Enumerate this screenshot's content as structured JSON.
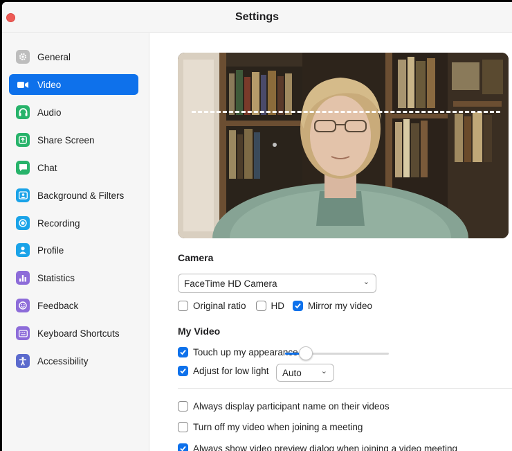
{
  "window": {
    "title": "Settings"
  },
  "sidebar": {
    "items": [
      {
        "label": "General",
        "icon": "gear-icon",
        "color": "#bdbdbd",
        "active": false
      },
      {
        "label": "Video",
        "icon": "video-camera-icon",
        "color": "#0e71eb",
        "active": true
      },
      {
        "label": "Audio",
        "icon": "headphones-icon",
        "color": "#27b36a",
        "active": false
      },
      {
        "label": "Share Screen",
        "icon": "share-screen-icon",
        "color": "#27b36a",
        "active": false
      },
      {
        "label": "Chat",
        "icon": "chat-bubble-icon",
        "color": "#27b36a",
        "active": false
      },
      {
        "label": "Background & Filters",
        "icon": "background-person-icon",
        "color": "#1aa3e8",
        "active": false
      },
      {
        "label": "Recording",
        "icon": "record-icon",
        "color": "#1aa3e8",
        "active": false
      },
      {
        "label": "Profile",
        "icon": "person-icon",
        "color": "#1aa3e8",
        "active": false
      },
      {
        "label": "Statistics",
        "icon": "bar-chart-icon",
        "color": "#8d6cd9",
        "active": false
      },
      {
        "label": "Feedback",
        "icon": "smiley-icon",
        "color": "#8d6cd9",
        "active": false
      },
      {
        "label": "Keyboard Shortcuts",
        "icon": "keyboard-icon",
        "color": "#8d6cd9",
        "active": false
      },
      {
        "label": "Accessibility",
        "icon": "accessibility-icon",
        "color": "#5b6acd",
        "active": false
      }
    ]
  },
  "camera": {
    "heading": "Camera",
    "selected": "FaceTime HD Camera",
    "options": [
      {
        "label": "Original ratio",
        "checked": false
      },
      {
        "label": "HD",
        "checked": false
      },
      {
        "label": "Mirror my video",
        "checked": true
      }
    ]
  },
  "my_video": {
    "heading": "My Video",
    "touch_up": {
      "label": "Touch up my appearance",
      "checked": true,
      "level": 0.2
    },
    "low_light": {
      "label": "Adjust for low light",
      "checked": true,
      "mode": "Auto"
    }
  },
  "more_options": [
    {
      "label": "Always display participant name on their videos",
      "checked": false
    },
    {
      "label": "Turn off my video when joining a meeting",
      "checked": false
    },
    {
      "label": "Always show video preview dialog when joining a video meeting",
      "checked": true
    }
  ],
  "colors": {
    "accent": "#0e71eb",
    "close": "#ee5a55"
  }
}
